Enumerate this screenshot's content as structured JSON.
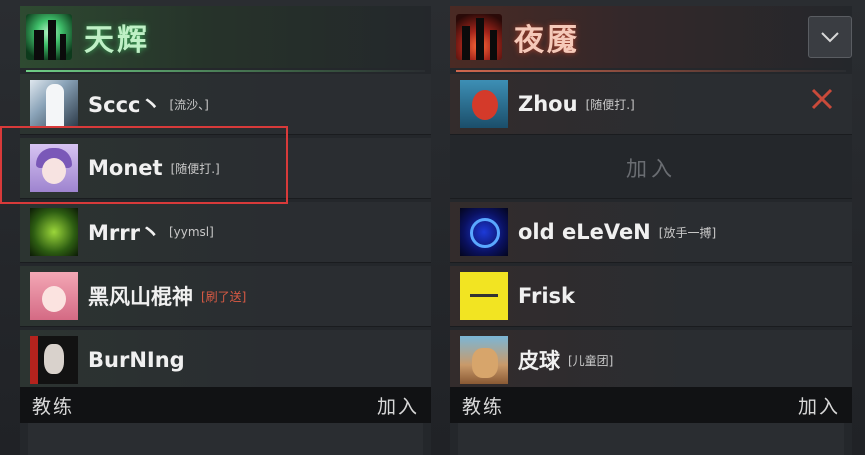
{
  "radiant": {
    "team_name": "天辉",
    "emblem_icon": "radiant-emblem",
    "players": [
      {
        "name": "Sccc丶",
        "tag": "[流沙、]",
        "avatar": "avatar-sccc"
      },
      {
        "name": "Monet",
        "tag": "[随便打.]",
        "avatar": "avatar-monet"
      },
      {
        "name": "Mrrr丶",
        "tag": "[yymsl]",
        "avatar": "avatar-mrrr"
      },
      {
        "name": "黑风山棍神",
        "tag": "[刷了送]",
        "avatar": "avatar-heifeng"
      },
      {
        "name": "BurNIng",
        "tag": "",
        "avatar": "avatar-burning"
      }
    ],
    "coach_label": "教练",
    "coach_join": "加入"
  },
  "dire": {
    "team_name": "夜魇",
    "emblem_icon": "dire-emblem",
    "players": [
      {
        "name": "Zhou",
        "tag": "[随便打.]",
        "avatar": "avatar-zhou",
        "kick_icon": "close-icon"
      },
      {
        "name": "",
        "tag": "",
        "empty_join": "加入"
      },
      {
        "name": "old eLeVeN",
        "tag": "[放手一搏]",
        "avatar": "avatar-oldeleven"
      },
      {
        "name": "Frisk",
        "tag": "",
        "avatar": "avatar-frisk"
      },
      {
        "name": "皮球",
        "tag": "[儿童团]",
        "avatar": "avatar-piqiu"
      }
    ],
    "coach_label": "教练",
    "coach_join": "加入"
  },
  "dropdown_icon": "chevron-down-icon",
  "colors": {
    "radiant_accent": "#6fcf86",
    "dire_accent": "#d0674e",
    "highlight": "#d83a3a",
    "kick": "#c94a3a"
  }
}
